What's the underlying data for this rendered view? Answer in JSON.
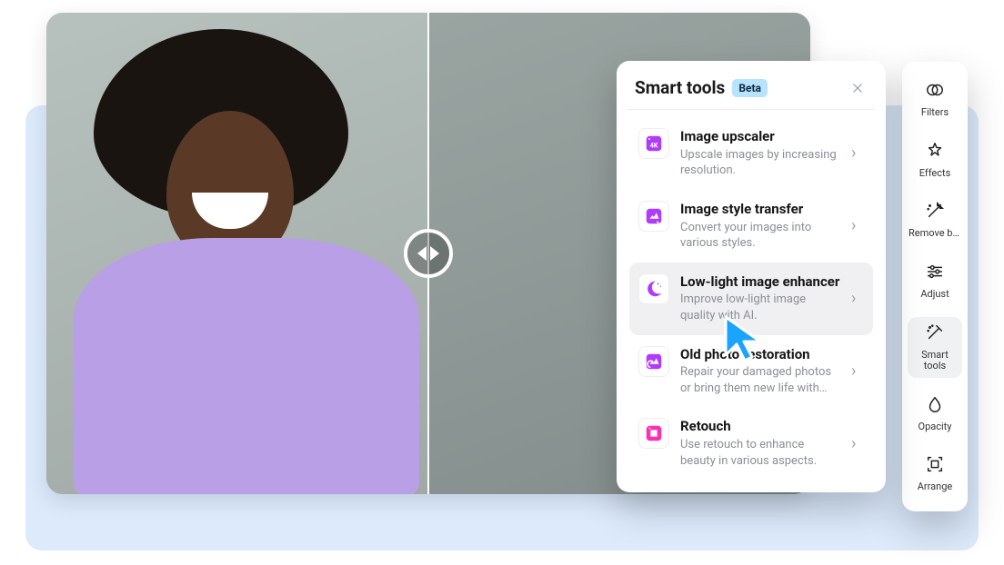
{
  "panel": {
    "title": "Smart tools",
    "badge": "Beta",
    "selected_index": 2,
    "tools": [
      {
        "name": "Image upscaler",
        "desc": "Upscale images by increasing resolution.",
        "icon": "upscale"
      },
      {
        "name": "Image style transfer",
        "desc": "Convert your images into various styles.",
        "icon": "style"
      },
      {
        "name": "Low-light image enhancer",
        "desc": "Improve low-light image quality with AI.",
        "icon": "moon"
      },
      {
        "name": "Old photo restoration",
        "desc": "Repair your damaged photos or bring them new life with…",
        "icon": "restore"
      },
      {
        "name": "Retouch",
        "desc": "Use retouch to enhance beauty in various aspects.",
        "icon": "retouch"
      }
    ]
  },
  "rail": {
    "active_index": 4,
    "items": [
      {
        "label": "Filters"
      },
      {
        "label": "Effects"
      },
      {
        "label": "Remove backgr…"
      },
      {
        "label": "Adjust"
      },
      {
        "label": "Smart tools"
      },
      {
        "label": "Opacity"
      },
      {
        "label": "Arrange"
      }
    ]
  },
  "icon_color": "#b03bff"
}
